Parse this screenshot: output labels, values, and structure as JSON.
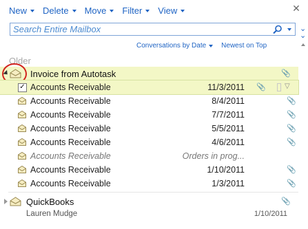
{
  "toolbar": {
    "new_label": "New",
    "delete_label": "Delete",
    "move_label": "Move",
    "filter_label": "Filter",
    "view_label": "View"
  },
  "search": {
    "placeholder": "Search Entire Mailbox"
  },
  "sort": {
    "conversations_label": "Conversations by Date",
    "order_label": "Newest on Top"
  },
  "section_label": "Older",
  "conversation": {
    "subject": "Invoice from Autotask",
    "has_attachment": true,
    "messages": [
      {
        "subject": "Accounts Receivable",
        "date": "11/3/2011",
        "selected": true,
        "pending": false
      },
      {
        "subject": "Accounts Receivable",
        "date": "8/4/2011",
        "selected": false,
        "pending": false
      },
      {
        "subject": "Accounts Receivable",
        "date": "7/7/2011",
        "selected": false,
        "pending": false
      },
      {
        "subject": "Accounts Receivable",
        "date": "5/5/2011",
        "selected": false,
        "pending": false
      },
      {
        "subject": "Accounts Receivable",
        "date": "4/6/2011",
        "selected": false,
        "pending": false
      },
      {
        "subject": "Accounts Receivable",
        "date": "Orders in prog...",
        "selected": false,
        "pending": true
      },
      {
        "subject": "Accounts Receivable",
        "date": "1/10/2011",
        "selected": false,
        "pending": false
      },
      {
        "subject": "Accounts Receivable",
        "date": "1/3/2011",
        "selected": false,
        "pending": false
      }
    ]
  },
  "next_conversation": {
    "subject": "QuickBooks",
    "sender": "Lauren Mudge",
    "date": "1/10/2011"
  },
  "colors": {
    "accent": "#1f64c4",
    "highlight": "#f3f7c6",
    "annotation_circle": "#d2241f"
  }
}
